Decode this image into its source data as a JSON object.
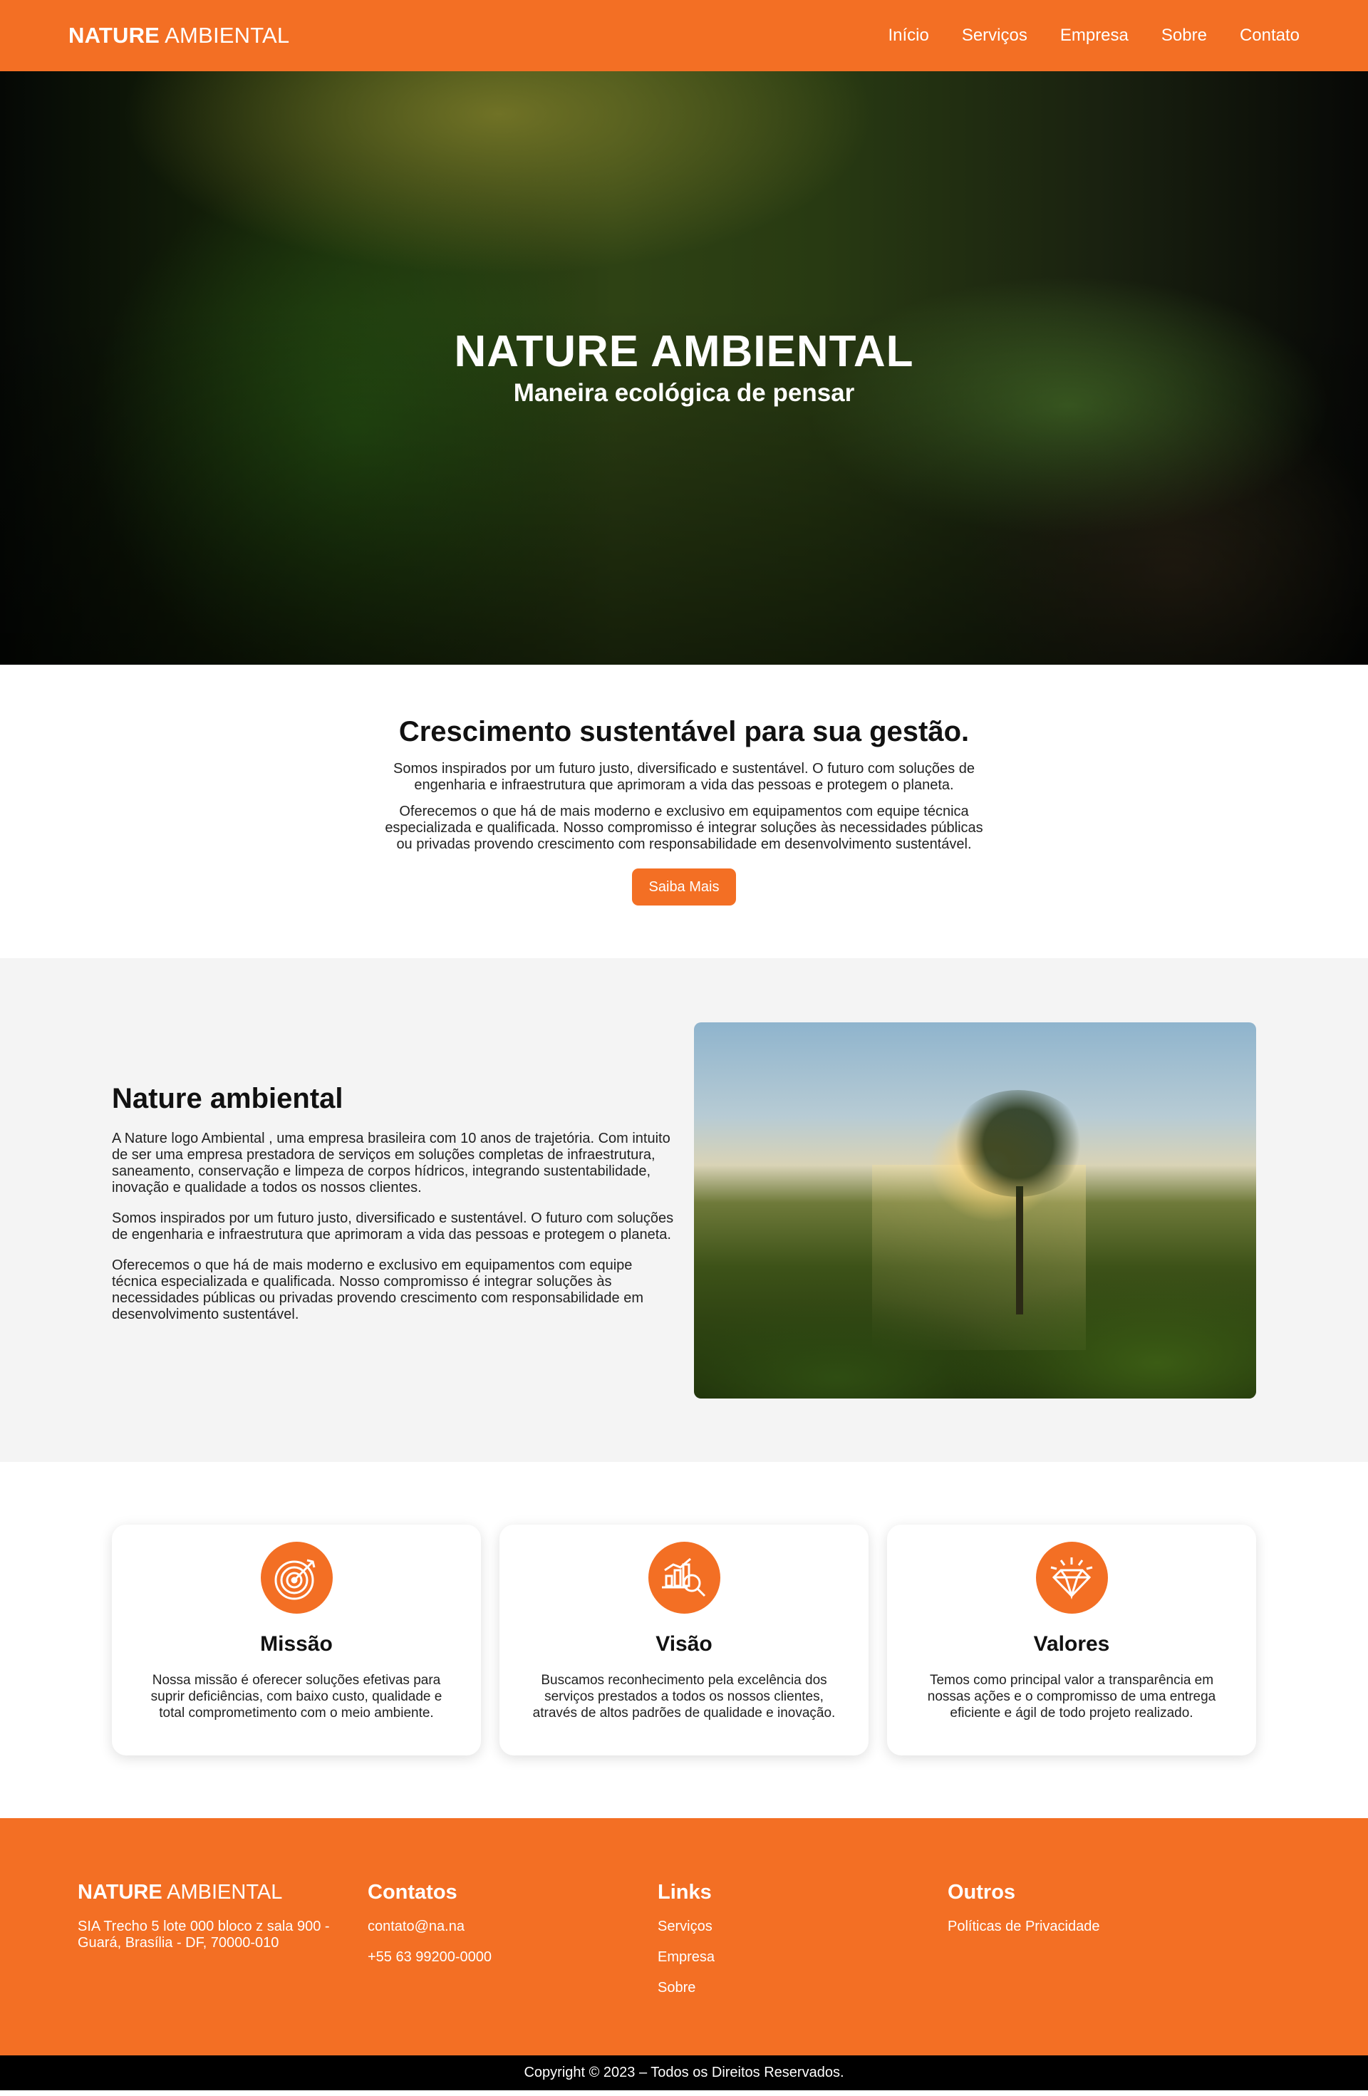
{
  "header": {
    "logo_bold": "NATURE",
    "logo_light": "AMBIENTAL",
    "nav": [
      "Início",
      "Serviços",
      "Empresa",
      "Sobre",
      "Contato"
    ]
  },
  "hero": {
    "title": "NATURE AMBIENTAL",
    "subtitle": "Maneira ecológica de pensar"
  },
  "intro": {
    "title": "Crescimento sustentável para sua gestão.",
    "p1": "Somos inspirados por um futuro justo, diversificado e sustentável. O futuro com soluções de engenharia e infraestrutura que aprimoram a vida das pessoas e protegem o planeta.",
    "p2": "Oferecemos o que há de mais moderno e exclusivo em equipamentos com equipe técnica especializada e qualificada. Nosso compromisso é integrar soluções às necessidades públicas ou privadas provendo crescimento com responsabilidade em desenvolvimento sustentável.",
    "button": "Saiba Mais"
  },
  "about": {
    "title": "Nature ambiental",
    "p1": "A Nature logo Ambiental , uma empresa brasileira com 10 anos de trajetória. Com intuito de ser uma empresa prestadora de serviços em soluções completas de infraestrutura, saneamento, conservação e limpeza de corpos hídricos, integrando sustentabilidade, inovação e qualidade a todos os nossos clientes.",
    "p2": "Somos inspirados por um futuro justo, diversificado e sustentável. O futuro com soluções de engenharia e infraestrutura que aprimoram a vida das pessoas e protegem o planeta.",
    "p3": "Oferecemos o que há de mais moderno e exclusivo em equipamentos com equipe técnica especializada e qualificada. Nosso compromisso é integrar soluções às necessidades públicas ou privadas provendo crescimento com responsabilidade em desenvolvimento sustentável."
  },
  "cards": [
    {
      "icon": "target-icon",
      "title": "Missão",
      "text": "Nossa missão é oferecer soluções efetivas para suprir deficiências, com baixo custo, qualidade e total comprometimento com o meio ambiente."
    },
    {
      "icon": "chart-search-icon",
      "title": "Visão",
      "text": "Buscamos reconhecimento pela excelência dos serviços prestados a todos os nossos clientes, através de altos padrões de qualidade e inovação."
    },
    {
      "icon": "diamond-icon",
      "title": "Valores",
      "text": "Temos como principal valor a transparência em nossas ações e o compromisso de uma entrega eficiente e ágil de todo projeto realizado."
    }
  ],
  "footer": {
    "logo_bold": "NATURE",
    "logo_light": "AMBIENTAL",
    "address": "SIA Trecho 5 lote 000 bloco z sala 900 - Guará, Brasília - DF, 70000-010",
    "contacts_title": "Contatos",
    "email": "contato@na.na",
    "phone": "+55 63 99200-0000",
    "links_title": "Links",
    "links": [
      "Serviços",
      "Empresa",
      "Sobre"
    ],
    "others_title": "Outros",
    "others": [
      "Políticas de Privacidade"
    ]
  },
  "copyright": "Copyright © 2023 – Todos os Direitos Reservados.",
  "colors": {
    "accent": "#f36f24",
    "about_bg": "#f4f4f4",
    "copyright_bg": "#000000"
  }
}
